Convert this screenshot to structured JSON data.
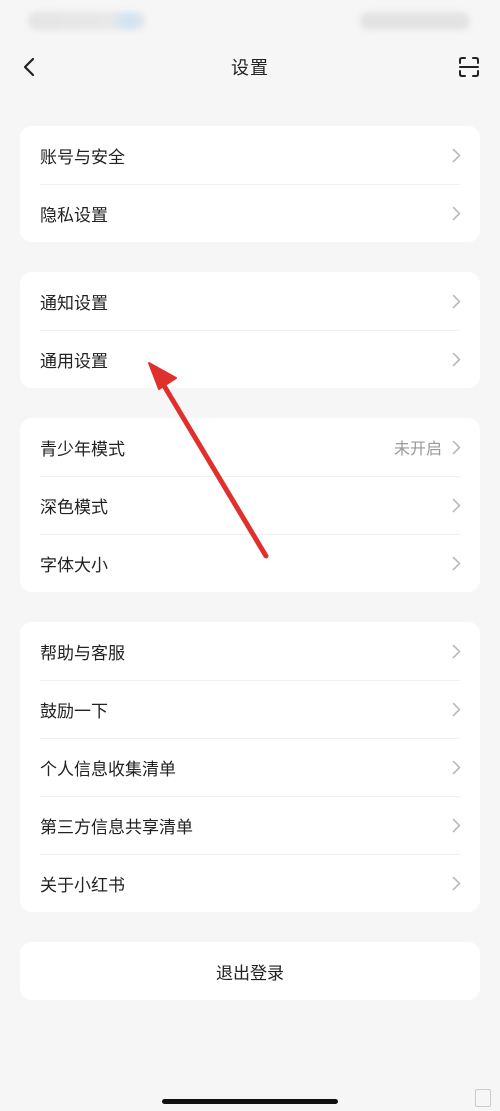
{
  "nav": {
    "title": "设置",
    "back_icon": "chevron-left-icon",
    "scan_icon": "scan-icon"
  },
  "groups": [
    {
      "items": [
        {
          "label": "账号与安全"
        },
        {
          "label": "隐私设置"
        }
      ]
    },
    {
      "items": [
        {
          "label": "通知设置"
        },
        {
          "label": "通用设置"
        }
      ]
    },
    {
      "items": [
        {
          "label": "青少年模式",
          "value": "未开启"
        },
        {
          "label": "深色模式"
        },
        {
          "label": "字体大小"
        }
      ]
    },
    {
      "items": [
        {
          "label": "帮助与客服"
        },
        {
          "label": "鼓励一下"
        },
        {
          "label": "个人信息收集清单"
        },
        {
          "label": "第三方信息共享清单"
        },
        {
          "label": "关于小红书"
        }
      ]
    }
  ],
  "logout": {
    "label": "退出登录"
  },
  "colors": {
    "background": "#f6f6f6",
    "card": "#ffffff",
    "text": "#222222",
    "secondary_text": "#999999",
    "chevron": "#bbbbbb",
    "annotation_arrow": "#e0302e"
  }
}
